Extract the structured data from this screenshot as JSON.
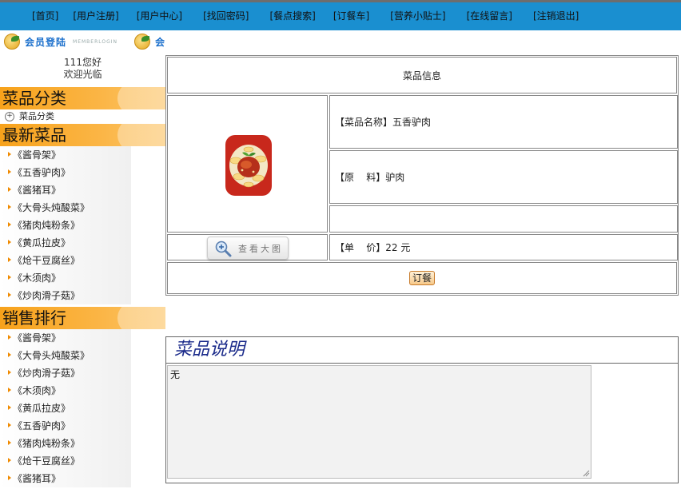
{
  "nav": {
    "items": [
      "[首页]",
      "[用户注册]",
      "[用户中心]",
      "[找回密码]",
      "[餐点搜索]",
      "[订餐车]",
      "[营养小贴士]",
      "[在线留言]",
      "[注销退出]"
    ]
  },
  "member": {
    "logo_text": "会员登陆",
    "logo_sub": "MEMBERLOGIN",
    "logo_text_partial": "会"
  },
  "sidebar": {
    "welcome_user": "111您好",
    "welcome_text": "欢迎光临",
    "categories_title": "菜品分类",
    "category_item": "菜品分类",
    "latest_title": "最新菜品",
    "latest_items": [
      "《酱骨架》",
      "《五香驴肉》",
      "《酱猪耳》",
      "《大骨头炖酸菜》",
      "《猪肉炖粉条》",
      "《黄瓜拉皮》",
      "《炝干豆腐丝》",
      "《木须肉》",
      "《炒肉滑子菇》"
    ],
    "sales_title": "销售排行",
    "sales_items": [
      "《酱骨架》",
      "《大骨头炖酸菜》",
      "《炒肉滑子菇》",
      "《木须肉》",
      "《黄瓜拉皮》",
      "《五香驴肉》",
      "《猪肉炖粉条》",
      "《炝干豆腐丝》",
      "《酱猪耳》"
    ]
  },
  "dish": {
    "header": "菜品信息",
    "name_label": "【菜品名称】",
    "name_value": "五香驴肉",
    "ingredient_label": "【原    料】",
    "ingredient_value": "驴肉",
    "price_label": "【单    价】",
    "price_value": "22 元",
    "view_button": "查看大图",
    "order_button": "订餐"
  },
  "description": {
    "title": "菜品说明",
    "content": "无"
  },
  "colors": {
    "nav_bg": "#1a8fd0",
    "section_orange": "#f7a21b",
    "desc_title": "#1a2a8a"
  }
}
